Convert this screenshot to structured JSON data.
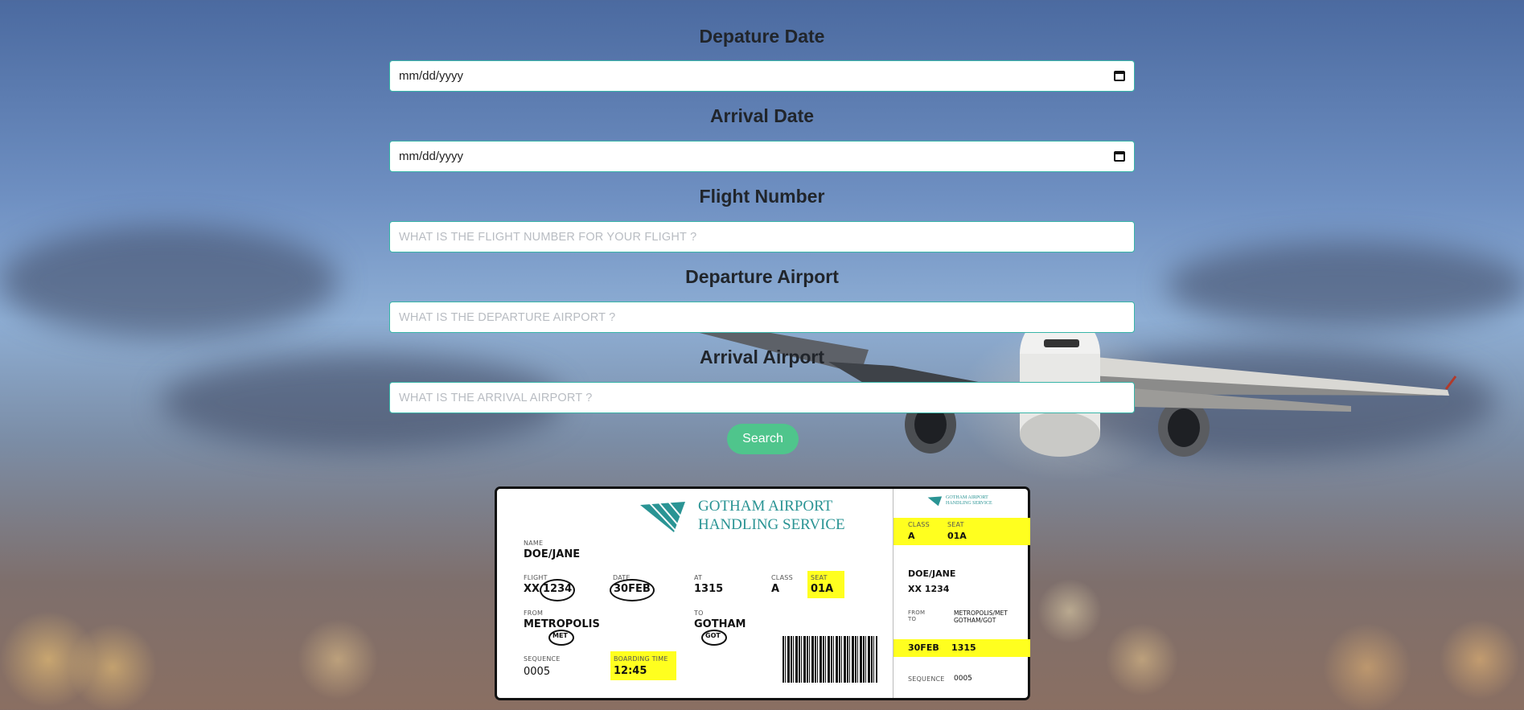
{
  "form": {
    "fields": [
      {
        "label": "Depature Date",
        "placeholder": "mm/dd/yyyy",
        "type": "date"
      },
      {
        "label": "Arrival Date",
        "placeholder": "mm/dd/yyyy",
        "type": "date"
      },
      {
        "label": "Flight Number",
        "placeholder": "WHAT IS THE FLIGHT NUMBER FOR YOUR FLIGHT ?",
        "type": "text"
      },
      {
        "label": "Departure Airport",
        "placeholder": "WHAT IS THE DEPARTURE AIRPORT ?",
        "type": "text"
      },
      {
        "label": "Arrival Airport",
        "placeholder": "WHAT IS THE ARRIVAL AIRPORT ?",
        "type": "text"
      }
    ],
    "search_label": "Search"
  },
  "ticket": {
    "brand_line1": "GOTHAM AIRPORT",
    "brand_line2": "HANDLING SERVICE",
    "name_label": "NAME",
    "name": "DOE/JANE",
    "flight_label": "FLIGHT",
    "flight_prefix": "XX",
    "flight_num": "1234",
    "date_label": "DATE",
    "date": "30FEB",
    "at_label": "AT",
    "at": "1315",
    "class_label": "CLASS",
    "class": "A",
    "seat_label": "SEAT",
    "seat": "01A",
    "from_label": "FROM",
    "from": "METROPOLIS",
    "from_code": "MET",
    "to_label": "TO",
    "to": "GOTHAM",
    "to_code": "GOT",
    "sequence_label": "SEQUENCE",
    "sequence": "0005",
    "boarding_label": "BOARDING TIME",
    "boarding": "12:45",
    "stub": {
      "brand_line1": "GOTHAM AIRPORT",
      "brand_line2": "HANDLING SERVICE",
      "flight": "XX 1234",
      "route_from": "METROPOLIS/MET",
      "route_to": "GOTHAM/GOT",
      "from_to_label1": "FROM",
      "from_to_label2": "TO",
      "date_time": "30FEB    1315",
      "sequence_label": "SEQUENCE",
      "sequence": "0005"
    }
  },
  "colors": {
    "accent": "#4fc58c",
    "border": "#38b5a8",
    "ticket_highlight": "#ffff1f",
    "brand": "#2a9494"
  }
}
